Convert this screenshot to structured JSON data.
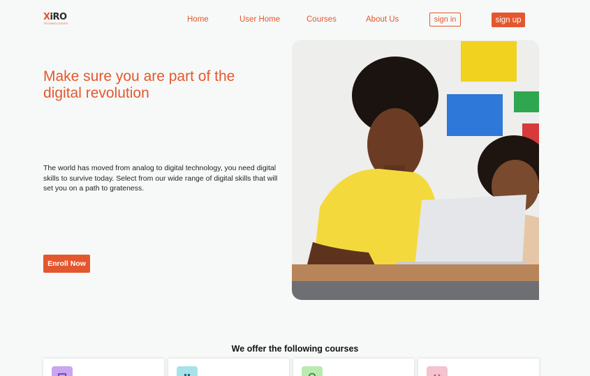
{
  "header": {
    "logo_text_x": "X",
    "logo_text_rest": "iRO",
    "logo_sub": "TECHNOLOGIES",
    "nav": [
      "Home",
      "User Home",
      "Courses",
      "About Us"
    ],
    "signin_label": "sign in",
    "signup_label": "sign up"
  },
  "hero": {
    "title": "Make sure you are part of the digital revolution",
    "description": "The world has moved from analog to digital technology, you need digital skills to survive today. Select from our wide range of digital skills that will set you on a path to grateness.",
    "enroll_label": "Enroll Now",
    "image_alt": "Students with laptop"
  },
  "courses": {
    "heading": "We offer the following courses",
    "cards": [
      {
        "icon": "monitor-icon",
        "color": "#c9a6ef"
      },
      {
        "icon": "grid-icon",
        "color": "#a8e1ea"
      },
      {
        "icon": "globe-icon",
        "color": "#b9eab1"
      },
      {
        "icon": "code-icon",
        "color": "#f3c3cf"
      }
    ]
  },
  "colors": {
    "accent": "#e4572e",
    "background": "#f7f9f8"
  }
}
